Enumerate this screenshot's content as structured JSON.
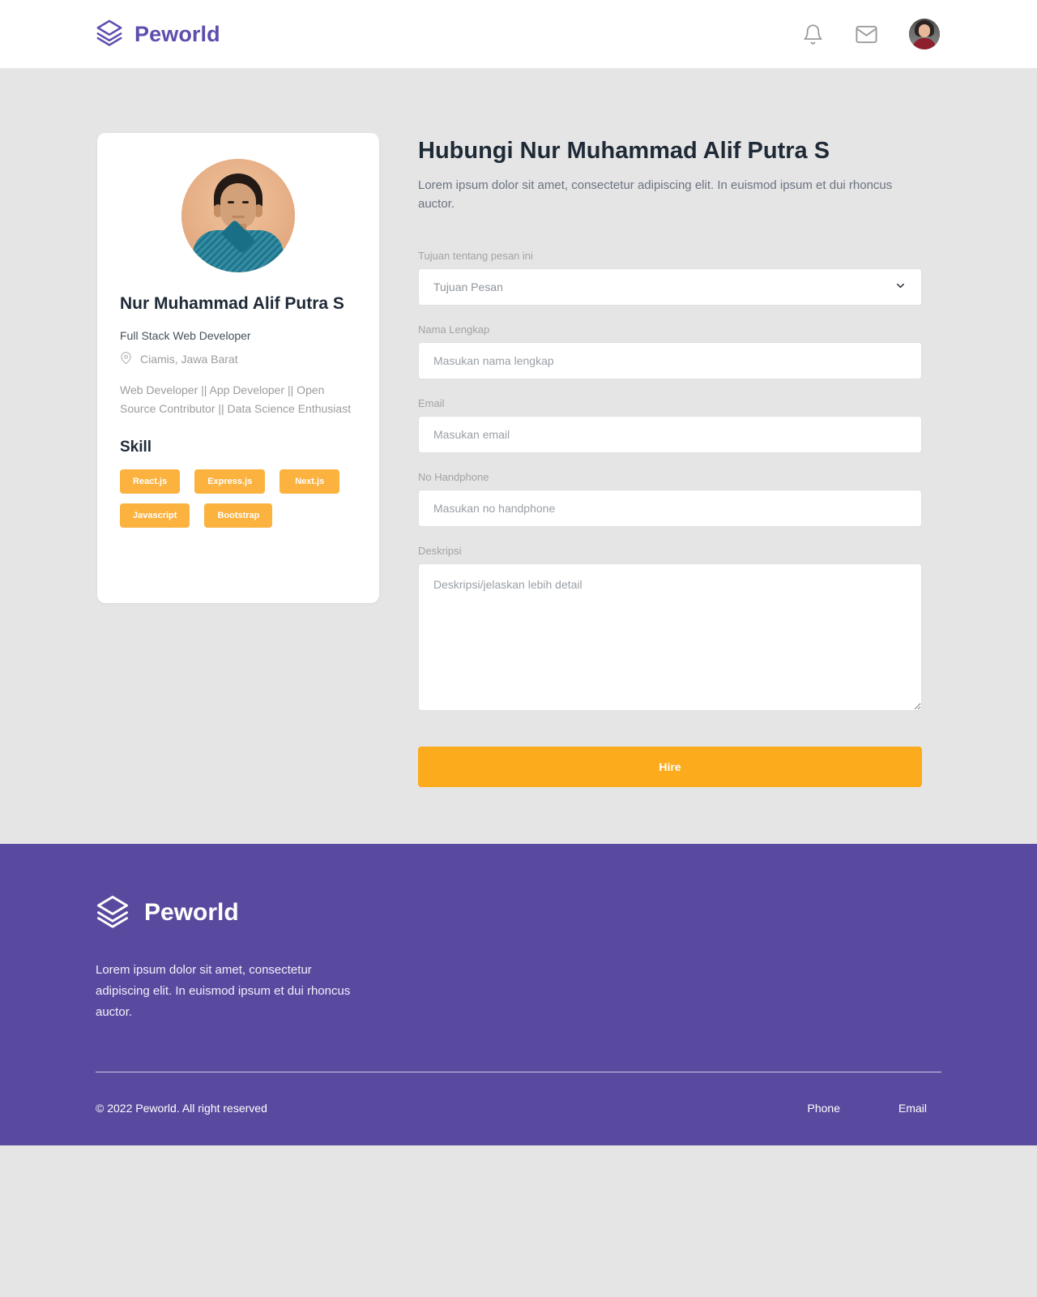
{
  "navbar": {
    "brand": "Peworld",
    "logo_icon": "layers-icon",
    "notification_icon": "bell-icon",
    "message_icon": "envelope-icon",
    "avatar_icon": "user-avatar"
  },
  "profile": {
    "photo_icon": "profile-photo",
    "name": "Nur Muhammad Alif Putra S",
    "role": "Full Stack Web Developer",
    "location_icon": "map-pin-icon",
    "location": "Ciamis, Jawa Barat",
    "description": "Web Developer || App Developer || Open Source Contributor || Data Science Enthusiast",
    "skill_heading": "Skill",
    "skills": [
      "React.js",
      "Express.js",
      "Next.js",
      "Javascript",
      "Bootstrap"
    ]
  },
  "contact": {
    "title": "Hubungi Nur Muhammad Alif Putra S",
    "subtitle": "Lorem ipsum dolor sit amet, consectetur adipiscing elit. In euismod ipsum et dui rhoncus auctor.",
    "fields": {
      "purpose": {
        "label": "Tujuan tentang pesan ini",
        "value": "Tujuan Pesan",
        "chevron_icon": "chevron-down-icon"
      },
      "fullname": {
        "label": "Nama Lengkap",
        "placeholder": "Masukan nama lengkap",
        "value": ""
      },
      "email": {
        "label": "Email",
        "placeholder": "Masukan email",
        "value": ""
      },
      "phone": {
        "label": "No Handphone",
        "placeholder": "Masukan no handphone",
        "value": ""
      },
      "description": {
        "label": "Deskripsi",
        "placeholder": "Deskripsi/jelaskan lebih detail",
        "value": ""
      }
    },
    "submit_label": "Hire"
  },
  "footer": {
    "brand": "Peworld",
    "logo_icon": "layers-icon",
    "description": "Lorem ipsum dolor sit amet, consectetur adipiscing elit. In euismod ipsum et dui rhoncus auctor.",
    "copyright": "© 2022 Peworld. All right reserved",
    "links": [
      "Phone",
      "Email"
    ]
  },
  "colors": {
    "brand_purple": "#5f4dae",
    "footer_purple": "#5a4a9f",
    "accent_orange": "#fbab1b",
    "badge_orange": "#fbb23f",
    "page_background": "#e5e5e5"
  }
}
